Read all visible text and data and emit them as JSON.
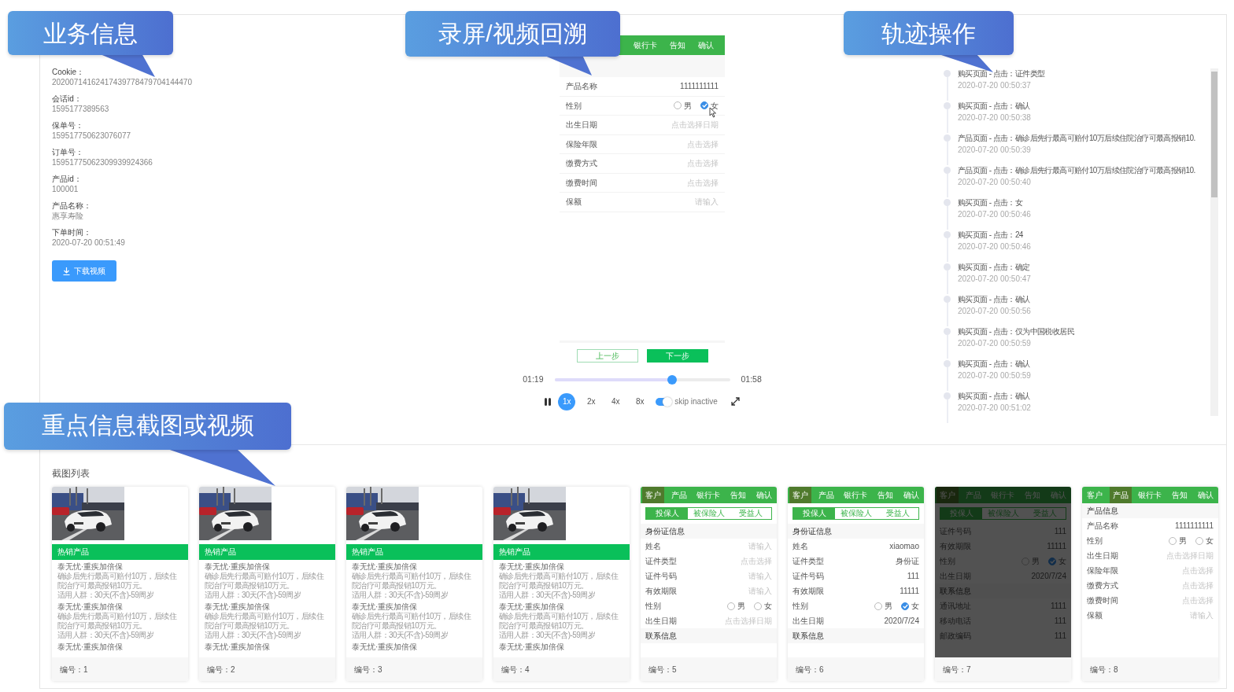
{
  "callouts": [
    {
      "text": "业务信息"
    },
    {
      "text": "录屏/视频回溯"
    },
    {
      "text": "轨迹操作"
    },
    {
      "text": "重点信息截图或视频"
    }
  ],
  "business_info": {
    "fields": [
      {
        "label": "Cookie：",
        "value": "20200714162417439778479704144470"
      },
      {
        "label": "会话id：",
        "value": "1595177389563"
      },
      {
        "label": "保单号：",
        "value": "159517750623076077"
      },
      {
        "label": "订单号：",
        "value": "15951775062309939924366"
      },
      {
        "label": "产品id：",
        "value": "100001"
      },
      {
        "label": "产品名称：",
        "value": "惠享寿险"
      },
      {
        "label": "下单时间：",
        "value": "2020-07-20 00:51:49"
      }
    ],
    "download_button": "下载视频"
  },
  "replay": {
    "screen": {
      "tabs": [
        {
          "label": "银行卡",
          "selected": false
        },
        {
          "label": "告知",
          "selected": false
        },
        {
          "label": "确认",
          "selected": false
        }
      ],
      "rows": [
        {
          "kind": "field",
          "label": "产品名称",
          "value": "1111111111"
        },
        {
          "kind": "radio",
          "label": "性别",
          "options": [
            {
              "label": "男",
              "selected": false
            },
            {
              "label": "女",
              "selected": true
            }
          ]
        },
        {
          "kind": "field",
          "label": "出生日期",
          "placeholder": "点击选择日期"
        },
        {
          "kind": "field",
          "label": "保险年限",
          "placeholder": "点击选择"
        },
        {
          "kind": "field",
          "label": "缴费方式",
          "placeholder": "点击选择"
        },
        {
          "kind": "field",
          "label": "缴费时间",
          "placeholder": "点击选择"
        },
        {
          "kind": "field",
          "label": "保额",
          "placeholder": "请输入"
        }
      ],
      "prev_button": "上一步",
      "next_button": "下一步"
    },
    "player": {
      "current_time": "01:19",
      "total_time": "01:58",
      "level": 0.67,
      "speeds": [
        {
          "label": "1x",
          "selected": true
        },
        {
          "label": "2x",
          "selected": false
        },
        {
          "label": "4x",
          "selected": false
        },
        {
          "label": "8x",
          "selected": false
        }
      ],
      "skip_inactive": {
        "label": "skip inactive",
        "on": true
      }
    }
  },
  "track": {
    "items": [
      {
        "action": "购买页面 - 点击：证件类型",
        "time": "2020-07-20 00:50:37"
      },
      {
        "action": "购买页面 - 点击：确认",
        "time": "2020-07-20 00:50:38"
      },
      {
        "action": "产品页面 - 点击：确诊后先行最高可赔付10万后续住院治疗可最高报销10.",
        "time": "2020-07-20 00:50:39"
      },
      {
        "action": "产品页面 - 点击：确诊后先行最高可赔付10万后续住院治疗可最高报销10.",
        "time": "2020-07-20 00:50:40"
      },
      {
        "action": "购买页面 - 点击：女",
        "time": "2020-07-20 00:50:46"
      },
      {
        "action": "购买页面 - 点击：24",
        "time": "2020-07-20 00:50:46"
      },
      {
        "action": "购买页面 - 点击：确定",
        "time": "2020-07-20 00:50:47"
      },
      {
        "action": "购买页面 - 点击：确认",
        "time": "2020-07-20 00:50:56"
      },
      {
        "action": "购买页面 - 点击：仅为中国税收居民",
        "time": "2020-07-20 00:50:59"
      },
      {
        "action": "购买页面 - 点击：确认",
        "time": "2020-07-20 00:50:59"
      },
      {
        "action": "购买页面 - 点击：确认",
        "time": "2020-07-20 00:51:02"
      }
    ]
  },
  "screenshots": {
    "title": "截图列表",
    "items": [
      {
        "kind": "product",
        "banner": "热销产品",
        "products": [
          {
            "title": "泰无忧·重疾加倍保",
            "description": "确诊后先行最高可赔付10万，后续住院治疗可最高报销10万元。",
            "audience": "适用人群：30天(不含)-59周岁"
          },
          {
            "title": "泰无忧·重疾加倍保",
            "description": "确诊后先行最高可赔付10万，后续住院治疗可最高报销10万元。",
            "audience": "适用人群：30天(不含)-59周岁"
          },
          {
            "title": "泰无忧·重疾加倍保"
          }
        ],
        "number": "编号：1"
      },
      {
        "kind": "product",
        "banner": "热销产品",
        "products": [
          {
            "title": "泰无忧·重疾加倍保",
            "description": "确诊后先行最高可赔付10万，后续住院治疗可最高报销10万元。",
            "audience": "适用人群：30天(不含)-59周岁"
          },
          {
            "title": "泰无忧·重疾加倍保",
            "description": "确诊后先行最高可赔付10万，后续住院治疗可最高报销10万元。",
            "audience": "适用人群：30天(不含)-59周岁"
          },
          {
            "title": "泰无忧·重疾加倍保"
          }
        ],
        "number": "编号：2"
      },
      {
        "kind": "product",
        "banner": "热销产品",
        "products": [
          {
            "title": "泰无忧·重疾加倍保",
            "description": "确诊后先行最高可赔付10万，后续住院治疗可最高报销10万元。",
            "audience": "适用人群：30天(不含)-59周岁"
          },
          {
            "title": "泰无忧·重疾加倍保",
            "description": "确诊后先行最高可赔付10万，后续住院治疗可最高报销10万元。",
            "audience": "适用人群：30天(不含)-59周岁"
          },
          {
            "title": "泰无忧·重疾加倍保"
          }
        ],
        "number": "编号：3"
      },
      {
        "kind": "product",
        "banner": "热销产品",
        "products": [
          {
            "title": "泰无忧·重疾加倍保",
            "description": "确诊后先行最高可赔付10万，后续住院治疗可最高报销10万元。",
            "audience": "适用人群：30天(不含)-59周岁"
          },
          {
            "title": "泰无忧·重疾加倍保",
            "description": "确诊后先行最高可赔付10万，后续住院治疗可最高报销10万元。",
            "audience": "适用人群：30天(不含)-59周岁"
          },
          {
            "title": "泰无忧·重疾加倍保"
          }
        ],
        "number": "编号：4"
      },
      {
        "kind": "form",
        "dimmed": false,
        "tabs": [
          {
            "label": "客户",
            "selected": true
          },
          {
            "label": "产品",
            "selected": false
          },
          {
            "label": "银行卡",
            "selected": false
          },
          {
            "label": "告知",
            "selected": false
          },
          {
            "label": "确认",
            "selected": false
          }
        ],
        "subtabs": [
          {
            "label": "投保人",
            "selected": true
          },
          {
            "label": "被保险人",
            "selected": false
          },
          {
            "label": "受益人",
            "selected": false
          }
        ],
        "rows": [
          {
            "kind": "section",
            "label": "身份证信息"
          },
          {
            "kind": "field",
            "label": "姓名",
            "placeholder": "请输入"
          },
          {
            "kind": "field",
            "label": "证件类型",
            "placeholder": "点击选择"
          },
          {
            "kind": "field",
            "label": "证件号码",
            "placeholder": "请输入"
          },
          {
            "kind": "field",
            "label": "有效期限",
            "placeholder": "请输入"
          },
          {
            "kind": "radio",
            "label": "性别",
            "options": [
              {
                "label": "男",
                "selected": false
              },
              {
                "label": "女",
                "selected": false
              }
            ]
          },
          {
            "kind": "field",
            "label": "出生日期",
            "placeholder": "点击选择日期"
          },
          {
            "kind": "section",
            "label": "联系信息"
          }
        ],
        "number": "编号：5"
      },
      {
        "kind": "form",
        "dimmed": false,
        "tabs": [
          {
            "label": "客户",
            "selected": true
          },
          {
            "label": "产品",
            "selected": false
          },
          {
            "label": "银行卡",
            "selected": false
          },
          {
            "label": "告知",
            "selected": false
          },
          {
            "label": "确认",
            "selected": false
          }
        ],
        "subtabs": [
          {
            "label": "投保人",
            "selected": true
          },
          {
            "label": "被保险人",
            "selected": false
          },
          {
            "label": "受益人",
            "selected": false
          }
        ],
        "rows": [
          {
            "kind": "section",
            "label": "身份证信息"
          },
          {
            "kind": "field",
            "label": "姓名",
            "value": "xiaomao"
          },
          {
            "kind": "field",
            "label": "证件类型",
            "value": "身份证"
          },
          {
            "kind": "field",
            "label": "证件号码",
            "value": "111"
          },
          {
            "kind": "field",
            "label": "有效期限",
            "value": "11111"
          },
          {
            "kind": "radio",
            "label": "性别",
            "options": [
              {
                "label": "男",
                "selected": false
              },
              {
                "label": "女",
                "selected": true
              }
            ]
          },
          {
            "kind": "field",
            "label": "出生日期",
            "value": "2020/7/24"
          },
          {
            "kind": "section",
            "label": "联系信息"
          }
        ],
        "number": "编号：6"
      },
      {
        "kind": "form",
        "dimmed": true,
        "tabs": [
          {
            "label": "客户",
            "selected": true
          },
          {
            "label": "产品",
            "selected": false
          },
          {
            "label": "银行卡",
            "selected": false
          },
          {
            "label": "告知",
            "selected": false
          },
          {
            "label": "确认",
            "selected": false
          }
        ],
        "subtabs": [
          {
            "label": "投保人",
            "selected": true
          },
          {
            "label": "被保险人",
            "selected": false
          },
          {
            "label": "受益人",
            "selected": false
          }
        ],
        "rows": [
          {
            "kind": "field",
            "label": "证件号码",
            "value": "111"
          },
          {
            "kind": "field",
            "label": "有效期限",
            "value": "11111"
          },
          {
            "kind": "radio",
            "label": "性别",
            "options": [
              {
                "label": "男",
                "selected": false
              },
              {
                "label": "女",
                "selected": true
              }
            ]
          },
          {
            "kind": "field",
            "label": "出生日期",
            "value": "2020/7/24"
          },
          {
            "kind": "section",
            "label": "联系信息"
          },
          {
            "kind": "field",
            "label": "通讯地址",
            "value": "1111"
          },
          {
            "kind": "field",
            "label": "移动电话",
            "value": "111"
          },
          {
            "kind": "field",
            "label": "邮政编码",
            "value": "111"
          }
        ],
        "number": "编号：7"
      },
      {
        "kind": "form",
        "dimmed": false,
        "tabs": [
          {
            "label": "客户",
            "selected": false
          },
          {
            "label": "产品",
            "selected": true
          },
          {
            "label": "银行卡",
            "selected": false
          },
          {
            "label": "告知",
            "selected": false
          },
          {
            "label": "确认",
            "selected": false
          }
        ],
        "rows": [
          {
            "kind": "section",
            "label": "产品信息"
          },
          {
            "kind": "field",
            "label": "产品名称",
            "value": "1111111111"
          },
          {
            "kind": "radio",
            "label": "性别",
            "options": [
              {
                "label": "男",
                "selected": false
              },
              {
                "label": "女",
                "selected": false
              }
            ]
          },
          {
            "kind": "field",
            "label": "出生日期",
            "placeholder": "点击选择日期"
          },
          {
            "kind": "field",
            "label": "保险年限",
            "placeholder": "点击选择"
          },
          {
            "kind": "field",
            "label": "缴费方式",
            "placeholder": "点击选择"
          },
          {
            "kind": "field",
            "label": "缴费时间",
            "placeholder": "点击选择"
          },
          {
            "kind": "field",
            "label": "保额",
            "placeholder": "请输入"
          }
        ],
        "number": "编号：8"
      }
    ]
  }
}
